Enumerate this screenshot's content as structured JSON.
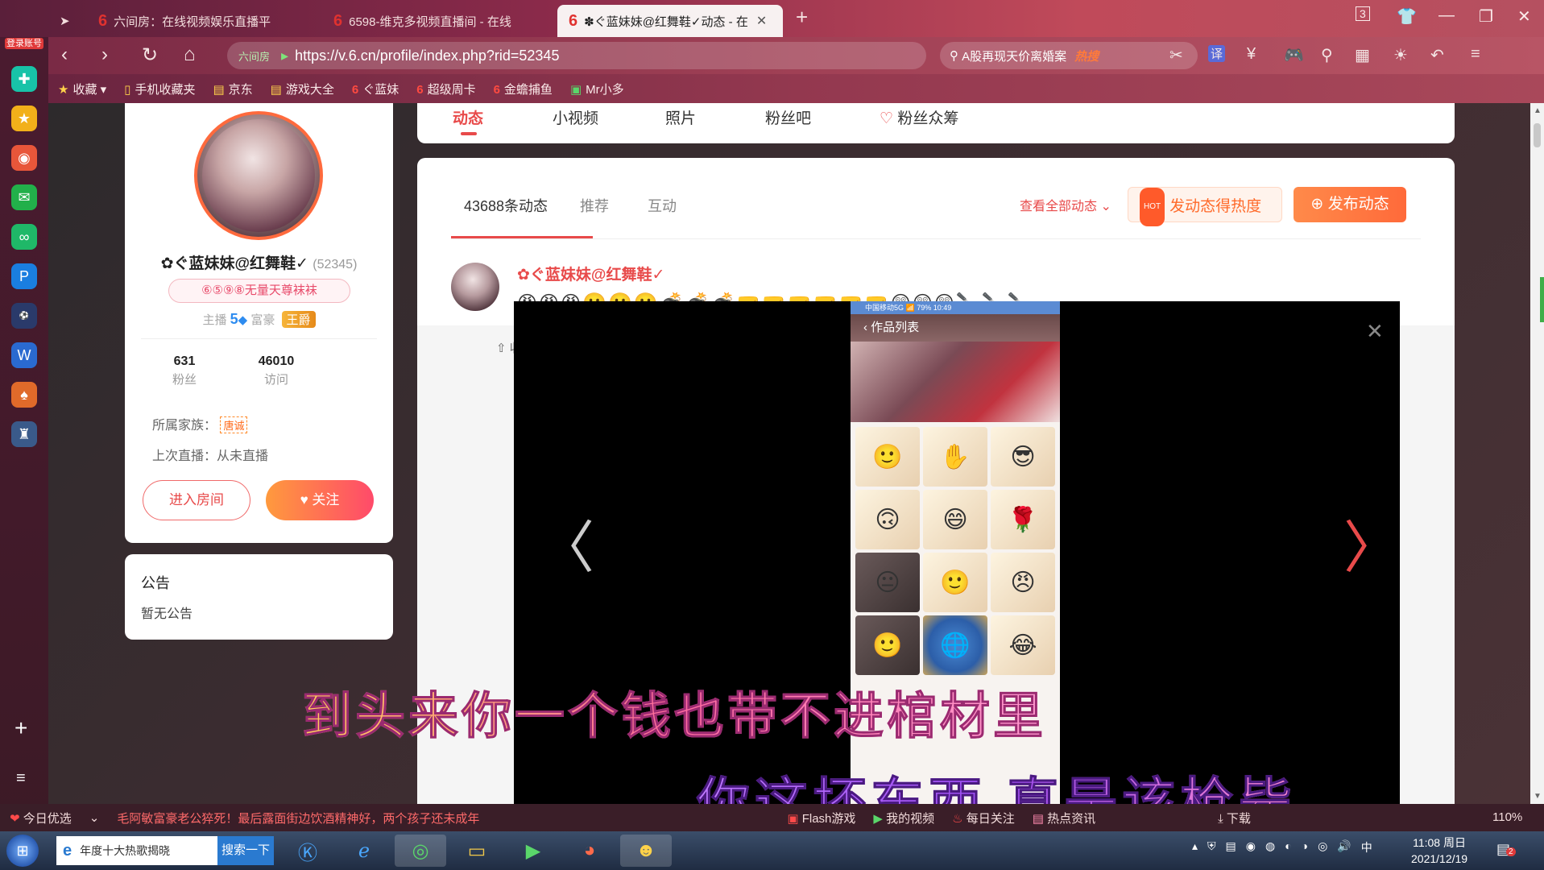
{
  "browser": {
    "tabs": [
      {
        "label": "六间房：在线视频娱乐直播平",
        "active": false
      },
      {
        "label": "6598-维克多视频直播间 - 在线",
        "active": false
      },
      {
        "label": "✽ぐ蓝妹妹@红舞鞋✓动态 - 在",
        "active": true
      }
    ],
    "tab_count": "3",
    "url": "https://v.6.cn/profile/index.php?rid=52345",
    "site_tag": "六间房",
    "search_text": "A股再现天价离婚案",
    "search_hot": "热搜",
    "sidebar_login": "登录账号",
    "bookmarks": [
      {
        "label": "收藏",
        "icon": "star-icon"
      },
      {
        "label": "手机收藏夹",
        "icon": "phone-icon"
      },
      {
        "label": "京东",
        "icon": "doc-icon"
      },
      {
        "label": "游戏大全",
        "icon": "doc-icon"
      },
      {
        "label": "ぐ蓝妹",
        "icon": "six-icon"
      },
      {
        "label": "超级周卡",
        "icon": "six-icon"
      },
      {
        "label": "金蟾捕鱼",
        "icon": "six-icon"
      },
      {
        "label": "Mr小多",
        "icon": "app-icon"
      }
    ]
  },
  "profile": {
    "name": "✿ぐ蓝妹妹@红舞鞋✓",
    "rid": "(52345)",
    "badge": "⑥⑤⑨⑧无量天尊袜袜",
    "role_anchor": "主播",
    "anchor_level": "5",
    "role_rich": "富豪",
    "rich_title": "王爵",
    "fans_count": "631",
    "fans_label": "粉丝",
    "visits_count": "46010",
    "visits_label": "访问",
    "family_label": "所属家族：",
    "family_tag": "唐诚",
    "last_live": "上次直播：从未直播",
    "enter_room": "进入房间",
    "follow": "关注"
  },
  "notice": {
    "title": "公告",
    "content": "暂无公告"
  },
  "nav_tabs": [
    "动态",
    "小视频",
    "照片",
    "粉丝吧",
    "粉丝众筹"
  ],
  "feed": {
    "tabs": [
      "43688条动态",
      "推荐",
      "互动"
    ],
    "view_all": "查看全部动态",
    "hot_button": "发动态得热度",
    "hot_badge": "HOT",
    "publish_button": "发布动态",
    "post_author": "✿ぐ蓝妹妹@红舞鞋✓",
    "post_emojis": [
      "😡",
      "😡",
      "😡",
      "😬",
      "😬",
      "😬",
      "💣",
      "💣",
      "💣",
      "🤜",
      "🤜",
      "🤜",
      "🤜",
      "🤜",
      "🤜",
      "😲",
      "😲",
      "😲",
      "🔪",
      "🔪",
      "🔪"
    ],
    "collapse": "收起"
  },
  "viewer": {
    "phone_status": "中国移动5G 📶  79% 10:49",
    "phone_title": "作品列表",
    "phone_cells": [
      "🙂",
      "✋",
      "😎",
      "🙃",
      "😄",
      "🌹",
      "😐",
      "🙂",
      "😠",
      "🙂",
      "🌐",
      "😂"
    ]
  },
  "subtitles": {
    "line1": "到头来你一个钱也带不进棺材里",
    "line2": "你这坏东西 真是该枪毙"
  },
  "statusbar": {
    "today": "今日优选",
    "news": "毛阿敏富豪老公猝死！最后露面街边饮酒精神好，两个孩子还未成年",
    "items": [
      "Flash游戏",
      "我的视频",
      "每日关注",
      "热点资讯",
      "下载"
    ],
    "zoom": "110%"
  },
  "taskbar": {
    "search_text": "年度十大热歌揭晓",
    "search_button": "搜索一下",
    "time": "11:08 周日",
    "date": "2021/12/19",
    "notify_count": "2"
  }
}
